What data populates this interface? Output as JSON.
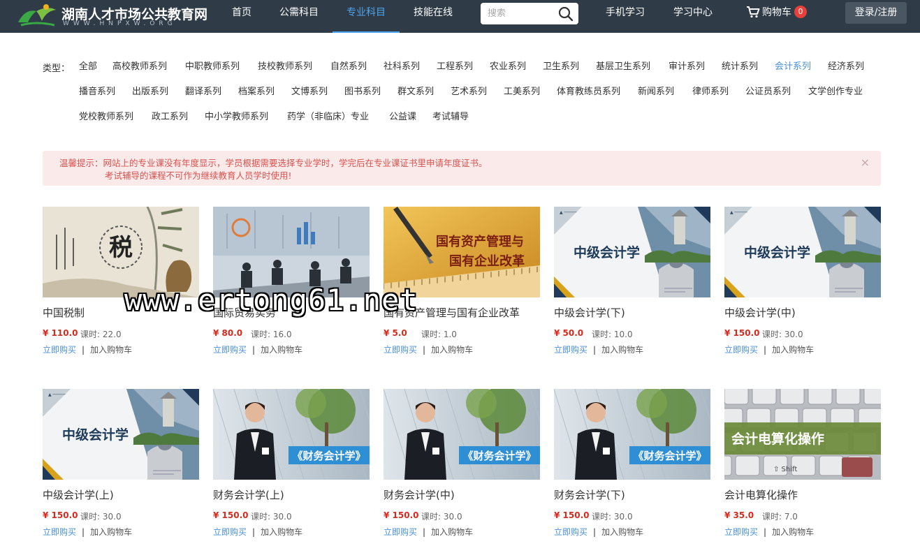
{
  "header": {
    "logo_name": "湖南人才市场公共教育网",
    "logo_url": "WWW.HNPXW.ORG",
    "nav": [
      "首页",
      "公需科目",
      "专业科目",
      "技能在线"
    ],
    "nav_active": 2,
    "search_placeholder": "搜索",
    "links": [
      "手机学习",
      "学习中心"
    ],
    "cart_label": "购物车",
    "cart_count": "0",
    "login_label": "登录/注册",
    "colors": {
      "bar": "#2f3b47",
      "active": "#4fa4ee",
      "badge": "#e8413b"
    }
  },
  "categories": {
    "label": "类型：",
    "active": "会计系列",
    "rows": [
      [
        "全部",
        "高校教师系列",
        "中职教师系列",
        "技校教师系列",
        "自然系列",
        "社科系列",
        "工程系列",
        "农业系列",
        "卫生系列",
        "基层卫生系列",
        "审计系列",
        "统计系列",
        "会计系列",
        "经济系列"
      ],
      [
        "播音系列",
        "出版系列",
        "翻译系列",
        "档案系列",
        "文博系列",
        "图书系列",
        "群文系列",
        "艺术系列",
        "工美系列",
        "体育教练员系列",
        "新闻系列",
        "律师系列",
        "公证员系列",
        "文学创作专业"
      ],
      [
        "党校教师系列",
        "政工系列",
        "中小学教师系列",
        "药学（非临床）专业",
        "公益课",
        "考试辅导"
      ]
    ]
  },
  "notice": {
    "line1": "温馨提示：网站上的专业课没有年度显示，学员根据需要选择专业学时，学完后在专业课证书里申请年度证书。",
    "line2": "考试辅导的课程不可作为继续教育人员学时使用!",
    "close": "×"
  },
  "course_actions": {
    "buy": "立即购买",
    "separator": "|",
    "add_cart": "加入购物车"
  },
  "courses": [
    {
      "title": "中国税制",
      "price": "¥ 110.0",
      "hours": "课时: 22.0",
      "image": "tax-art",
      "image_text": "税"
    },
    {
      "title": "国际贸易实务",
      "price": "¥ 80.0",
      "hours": "课时: 16.0",
      "image": "business-meeting",
      "image_text": ""
    },
    {
      "title": "国有资产管理与国有企业改革",
      "price": "¥ 5.0",
      "hours": "课时: 1.0",
      "image": "pen-and-ruler",
      "image_text": "国有资产管理与\n国有企业改革"
    },
    {
      "title": "中级会计学(下)",
      "price": "¥ 50.0",
      "hours": "课时: 10.0",
      "image": "campus-banner",
      "image_text": "中级会计学"
    },
    {
      "title": "中级会计学(中)",
      "price": "¥ 150.0",
      "hours": "课时: 30.0",
      "image": "campus-banner",
      "image_text": "中级会计学"
    },
    {
      "title": "中级会计学(上)",
      "price": "¥ 150.0",
      "hours": "课时: 30.0",
      "image": "campus-banner",
      "image_text": "中级会计学"
    },
    {
      "title": "财务会计学(上)",
      "price": "¥ 150.0",
      "hours": "课时: 30.0",
      "image": "businesswoman",
      "image_text": "《财务会计学》"
    },
    {
      "title": "财务会计学(中)",
      "price": "¥ 150.0",
      "hours": "课时: 30.0",
      "image": "businesswoman",
      "image_text": "《财务会计学》"
    },
    {
      "title": "财务会计学(下)",
      "price": "¥ 150.0",
      "hours": "课时: 30.0",
      "image": "businesswoman",
      "image_text": "《财务会计学》"
    },
    {
      "title": "会计电算化操作",
      "price": "¥ 35.0",
      "hours": "课时: 7.0",
      "image": "keyboard",
      "image_text": "会计电算化操作"
    }
  ],
  "watermark": "www.ertong61.net"
}
